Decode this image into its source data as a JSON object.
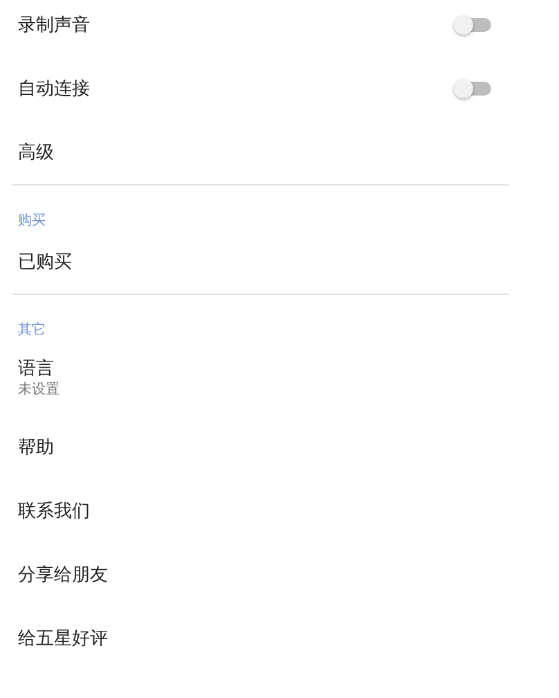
{
  "groups": [
    {
      "items": [
        {
          "kind": "switch",
          "title": "录制声音",
          "on": false
        },
        {
          "kind": "switch",
          "title": "自动连接",
          "on": false
        },
        {
          "kind": "plain",
          "title": "高级"
        }
      ]
    },
    {
      "header": "购买",
      "items": [
        {
          "kind": "plain",
          "title": "已购买"
        }
      ]
    },
    {
      "header": "其它",
      "items": [
        {
          "kind": "plain",
          "title": "语言",
          "summary": "未设置"
        },
        {
          "kind": "plain",
          "title": "帮助"
        },
        {
          "kind": "plain",
          "title": "联系我们"
        },
        {
          "kind": "plain",
          "title": "分享给朋友"
        },
        {
          "kind": "plain",
          "title": "给五星好评"
        }
      ]
    }
  ]
}
